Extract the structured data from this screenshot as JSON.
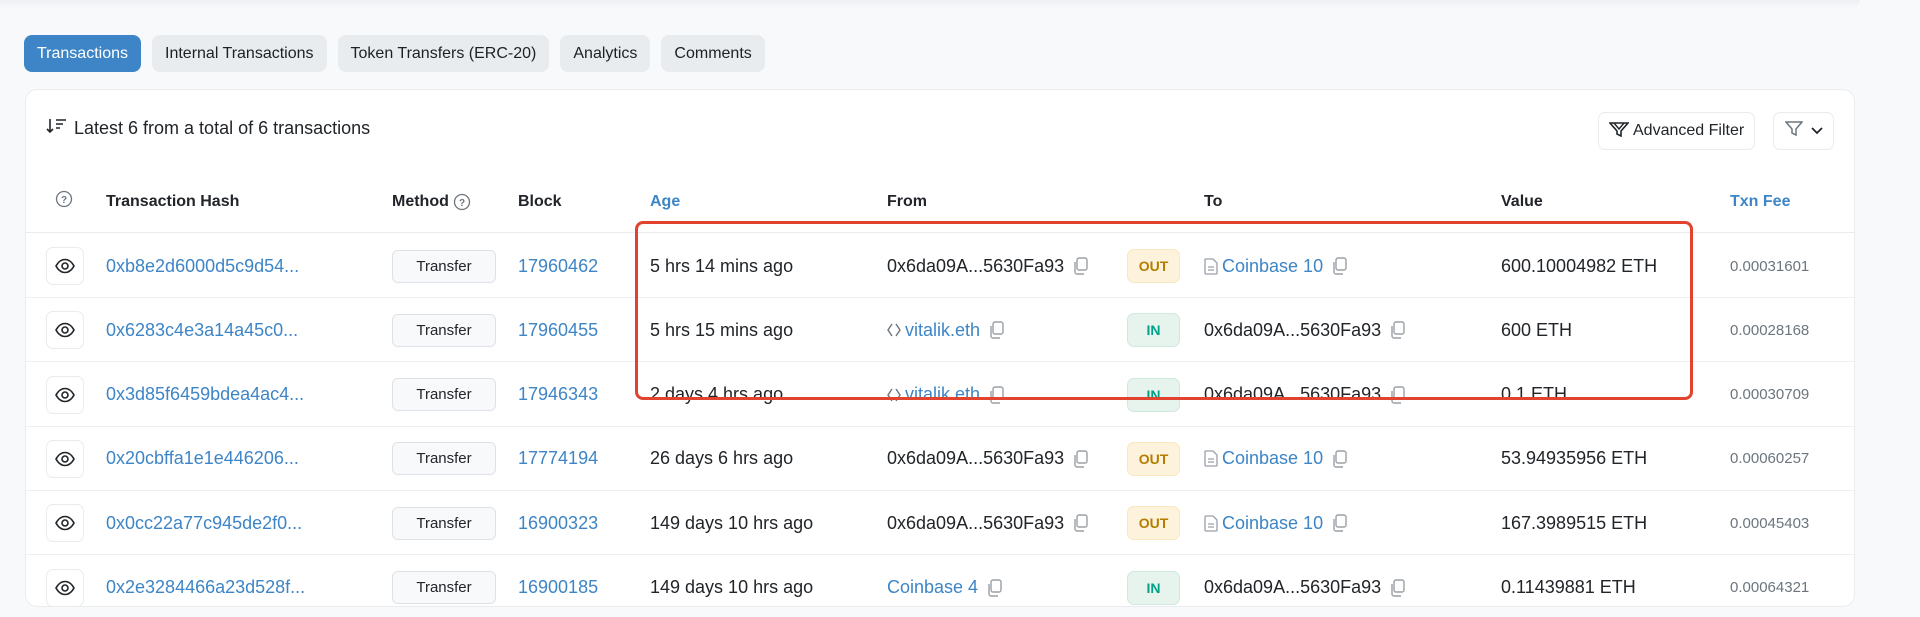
{
  "tabs": [
    {
      "label": "Transactions",
      "active": true
    },
    {
      "label": "Internal Transactions",
      "active": false
    },
    {
      "label": "Token Transfers (ERC-20)",
      "active": false
    },
    {
      "label": "Analytics",
      "active": false
    },
    {
      "label": "Comments",
      "active": false
    }
  ],
  "summary": {
    "text": "Latest 6 from a total of 6 transactions",
    "icon": "sort-descending-icon"
  },
  "toolbar": {
    "advanced_filter_label": "Advanced Filter",
    "advanced_filter_icon": "advanced-filter-icon",
    "filter_icon": "filter-icon",
    "dropdown_icon": "chevron-down-icon"
  },
  "table": {
    "columns": {
      "info": "?",
      "hash": "Transaction Hash",
      "method": "Method",
      "block": "Block",
      "age": "Age",
      "from": "From",
      "to": "To",
      "value": "Value",
      "fee": "Txn Fee"
    },
    "rows": [
      {
        "hash": "0xb8e2d6000d5c9d54...",
        "method": "Transfer",
        "block": "17960462",
        "age": "5 hrs 14 mins ago",
        "from": "0x6da09A...5630Fa93",
        "from_type": "address",
        "direction": "OUT",
        "to": "Coinbase 10",
        "to_type": "contract-link",
        "value": "600.10004982 ETH",
        "fee": "0.00031601"
      },
      {
        "hash": "0x6283c4e3a14a45c0...",
        "method": "Transfer",
        "block": "17960455",
        "age": "5 hrs 15 mins ago",
        "from": "vitalik.eth",
        "from_type": "ens-link",
        "direction": "IN",
        "to": "0x6da09A...5630Fa93",
        "to_type": "address",
        "value": "600 ETH",
        "fee": "0.00028168"
      },
      {
        "hash": "0x3d85f6459bdea4ac4...",
        "method": "Transfer",
        "block": "17946343",
        "age": "2 days 4 hrs ago",
        "from": "vitalik.eth",
        "from_type": "ens-link",
        "direction": "IN",
        "to": "0x6da09A...5630Fa93",
        "to_type": "address",
        "value": "0.1 ETH",
        "fee": "0.00030709"
      },
      {
        "hash": "0x20cbffa1e1e446206...",
        "method": "Transfer",
        "block": "17774194",
        "age": "26 days 6 hrs ago",
        "from": "0x6da09A...5630Fa93",
        "from_type": "address",
        "direction": "OUT",
        "to": "Coinbase 10",
        "to_type": "contract-link",
        "value": "53.94935956 ETH",
        "fee": "0.00060257"
      },
      {
        "hash": "0x0cc22a77c945de2f0...",
        "method": "Transfer",
        "block": "16900323",
        "age": "149 days 10 hrs ago",
        "from": "0x6da09A...5630Fa93",
        "from_type": "address",
        "direction": "OUT",
        "to": "Coinbase 10",
        "to_type": "contract-link",
        "value": "167.3989515 ETH",
        "fee": "0.00045403"
      },
      {
        "hash": "0x2e3284466a23d528f...",
        "method": "Transfer",
        "block": "16900185",
        "age": "149 days 10 hrs ago",
        "from": "Coinbase 4",
        "from_type": "link",
        "direction": "IN",
        "to": "0x6da09A...5630Fa93",
        "to_type": "address",
        "value": "0.11439881 ETH",
        "fee": "0.00064321"
      }
    ]
  },
  "colors": {
    "accent": "#3d85c6",
    "out_badge": "#b47d00",
    "in_badge": "#00a186",
    "highlight_box": "#e1432f"
  }
}
